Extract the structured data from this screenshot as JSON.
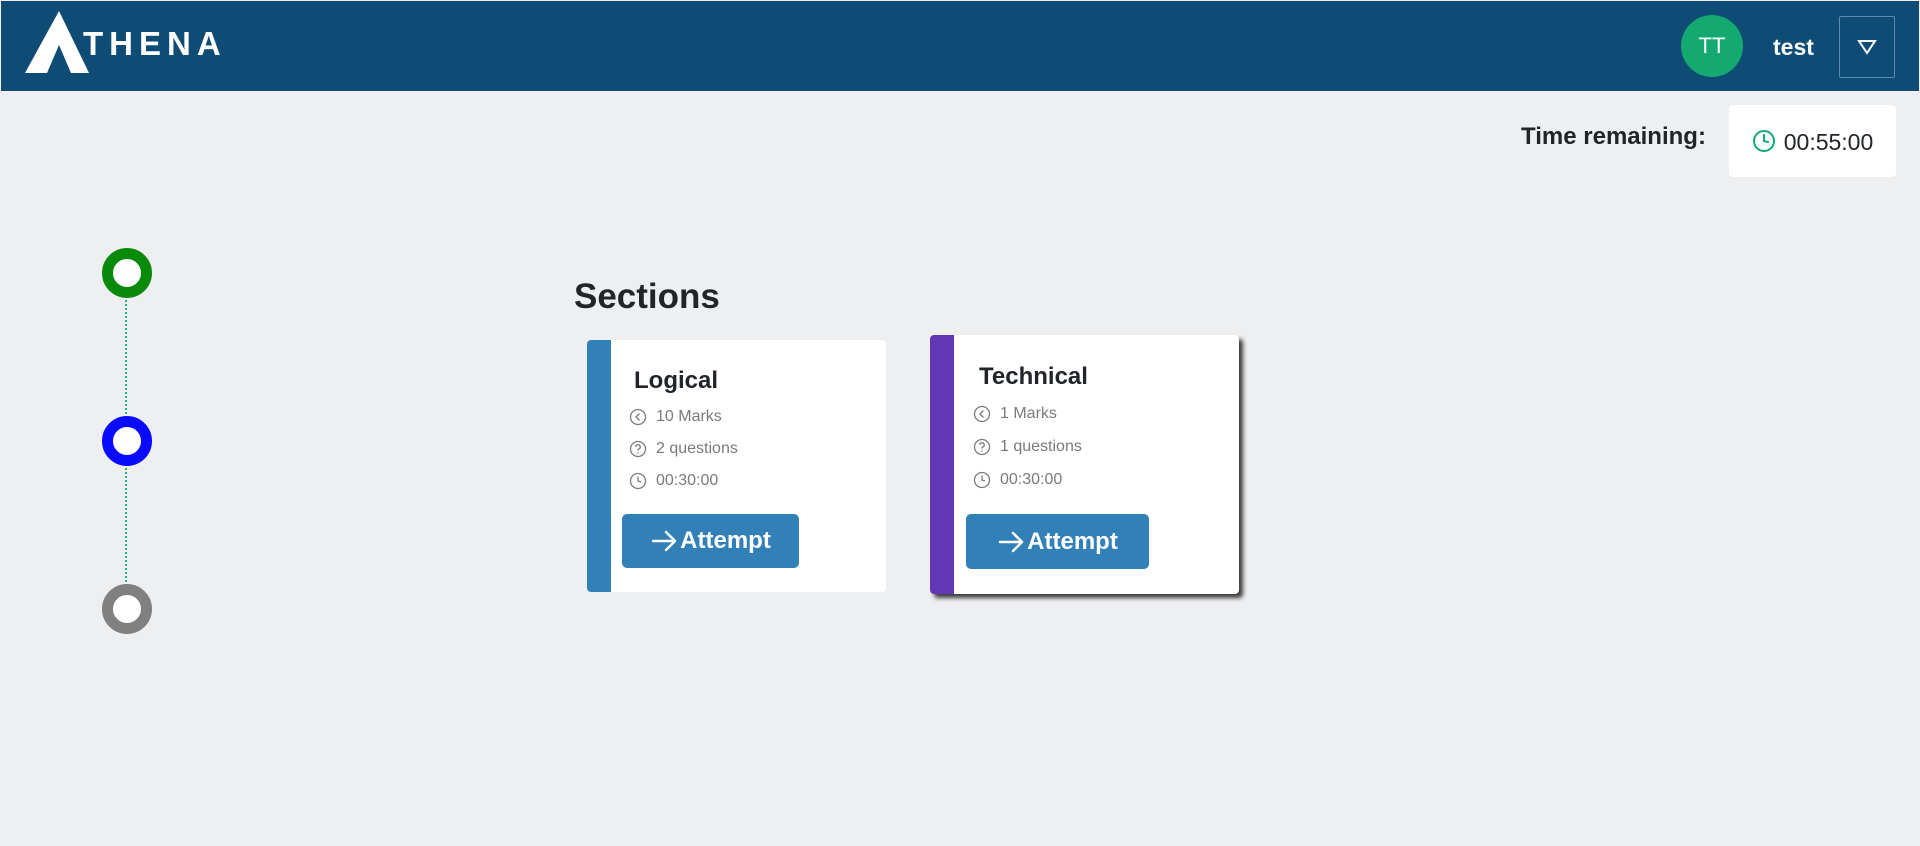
{
  "header": {
    "logo_text": "THENA",
    "avatar_initials": "TT",
    "username": "test",
    "colors": {
      "bar": "#0f4c75",
      "avatar": "#13a970"
    }
  },
  "timer": {
    "label": "Time remaining:",
    "value": "00:55:00",
    "icon": "clock-icon"
  },
  "stepper": {
    "steps": [
      {
        "status": "completed",
        "color": "#0a8a0a"
      },
      {
        "status": "active",
        "color": "#0a0aff"
      },
      {
        "status": "pending",
        "color": "#808080"
      }
    ]
  },
  "sections": {
    "title": "Sections",
    "cards": [
      {
        "title": "Logical",
        "marks": "10 Marks",
        "questions": "2 questions",
        "duration": "00:30:00",
        "button_label": "Attempt",
        "accent": "#3280b8"
      },
      {
        "title": "Technical",
        "marks": "1 Marks",
        "questions": "1 questions",
        "duration": "00:30:00",
        "button_label": "Attempt",
        "accent": "#6336b8"
      }
    ]
  }
}
